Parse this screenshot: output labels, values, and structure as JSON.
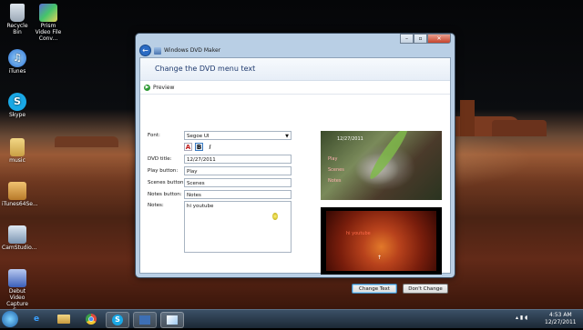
{
  "desktop": {
    "icons": [
      {
        "label": "Recycle Bin",
        "icon": "recycle-bin-icon"
      },
      {
        "label": "Prism Video File Conv...",
        "icon": "prism-icon"
      },
      {
        "label": "iTunes",
        "icon": "itunes-icon"
      },
      {
        "label": "Skype",
        "icon": "skype-icon"
      },
      {
        "label": "music",
        "icon": "folder-icon"
      },
      {
        "label": "iTunes64Se...",
        "icon": "installer-icon"
      },
      {
        "label": "CamStudio...",
        "icon": "camstudio-icon"
      },
      {
        "label": "Debut Video Capture S...",
        "icon": "debut-icon"
      }
    ]
  },
  "window": {
    "title": "Windows DVD Maker",
    "header": "Change the DVD menu text",
    "toolbar": {
      "preview_label": "Preview"
    },
    "form": {
      "font_label": "Font:",
      "font_value": "Segoe UI",
      "format_buttons": {
        "color": "A",
        "bold": "B",
        "italic": "I"
      },
      "dvd_title_label": "DVD title:",
      "dvd_title_value": "12/27/2011",
      "play_label": "Play button:",
      "play_value": "Play",
      "scenes_label": "Scenes button:",
      "scenes_value": "Scenes",
      "notes_button_label": "Notes button:",
      "notes_button_value": "Notes",
      "notes_label": "Notes:",
      "notes_value": "hi youtube"
    },
    "preview_top": {
      "title_overlay": "12/27/2011",
      "play": "Play",
      "scenes": "Scenes",
      "notes": "Notes"
    },
    "preview_bottom": {
      "notes_text": "hi youtube"
    },
    "buttons": {
      "change_text": "Change Text",
      "dont_change": "Don't Change"
    }
  },
  "taskbar": {
    "apps": [
      "start-orb-icon",
      "ie-icon",
      "explorer-icon",
      "chrome-icon",
      "skype-icon",
      "dvd-maker-icon",
      "paint-icon"
    ],
    "time": "4:53 AM",
    "date": "12/27/2011"
  }
}
